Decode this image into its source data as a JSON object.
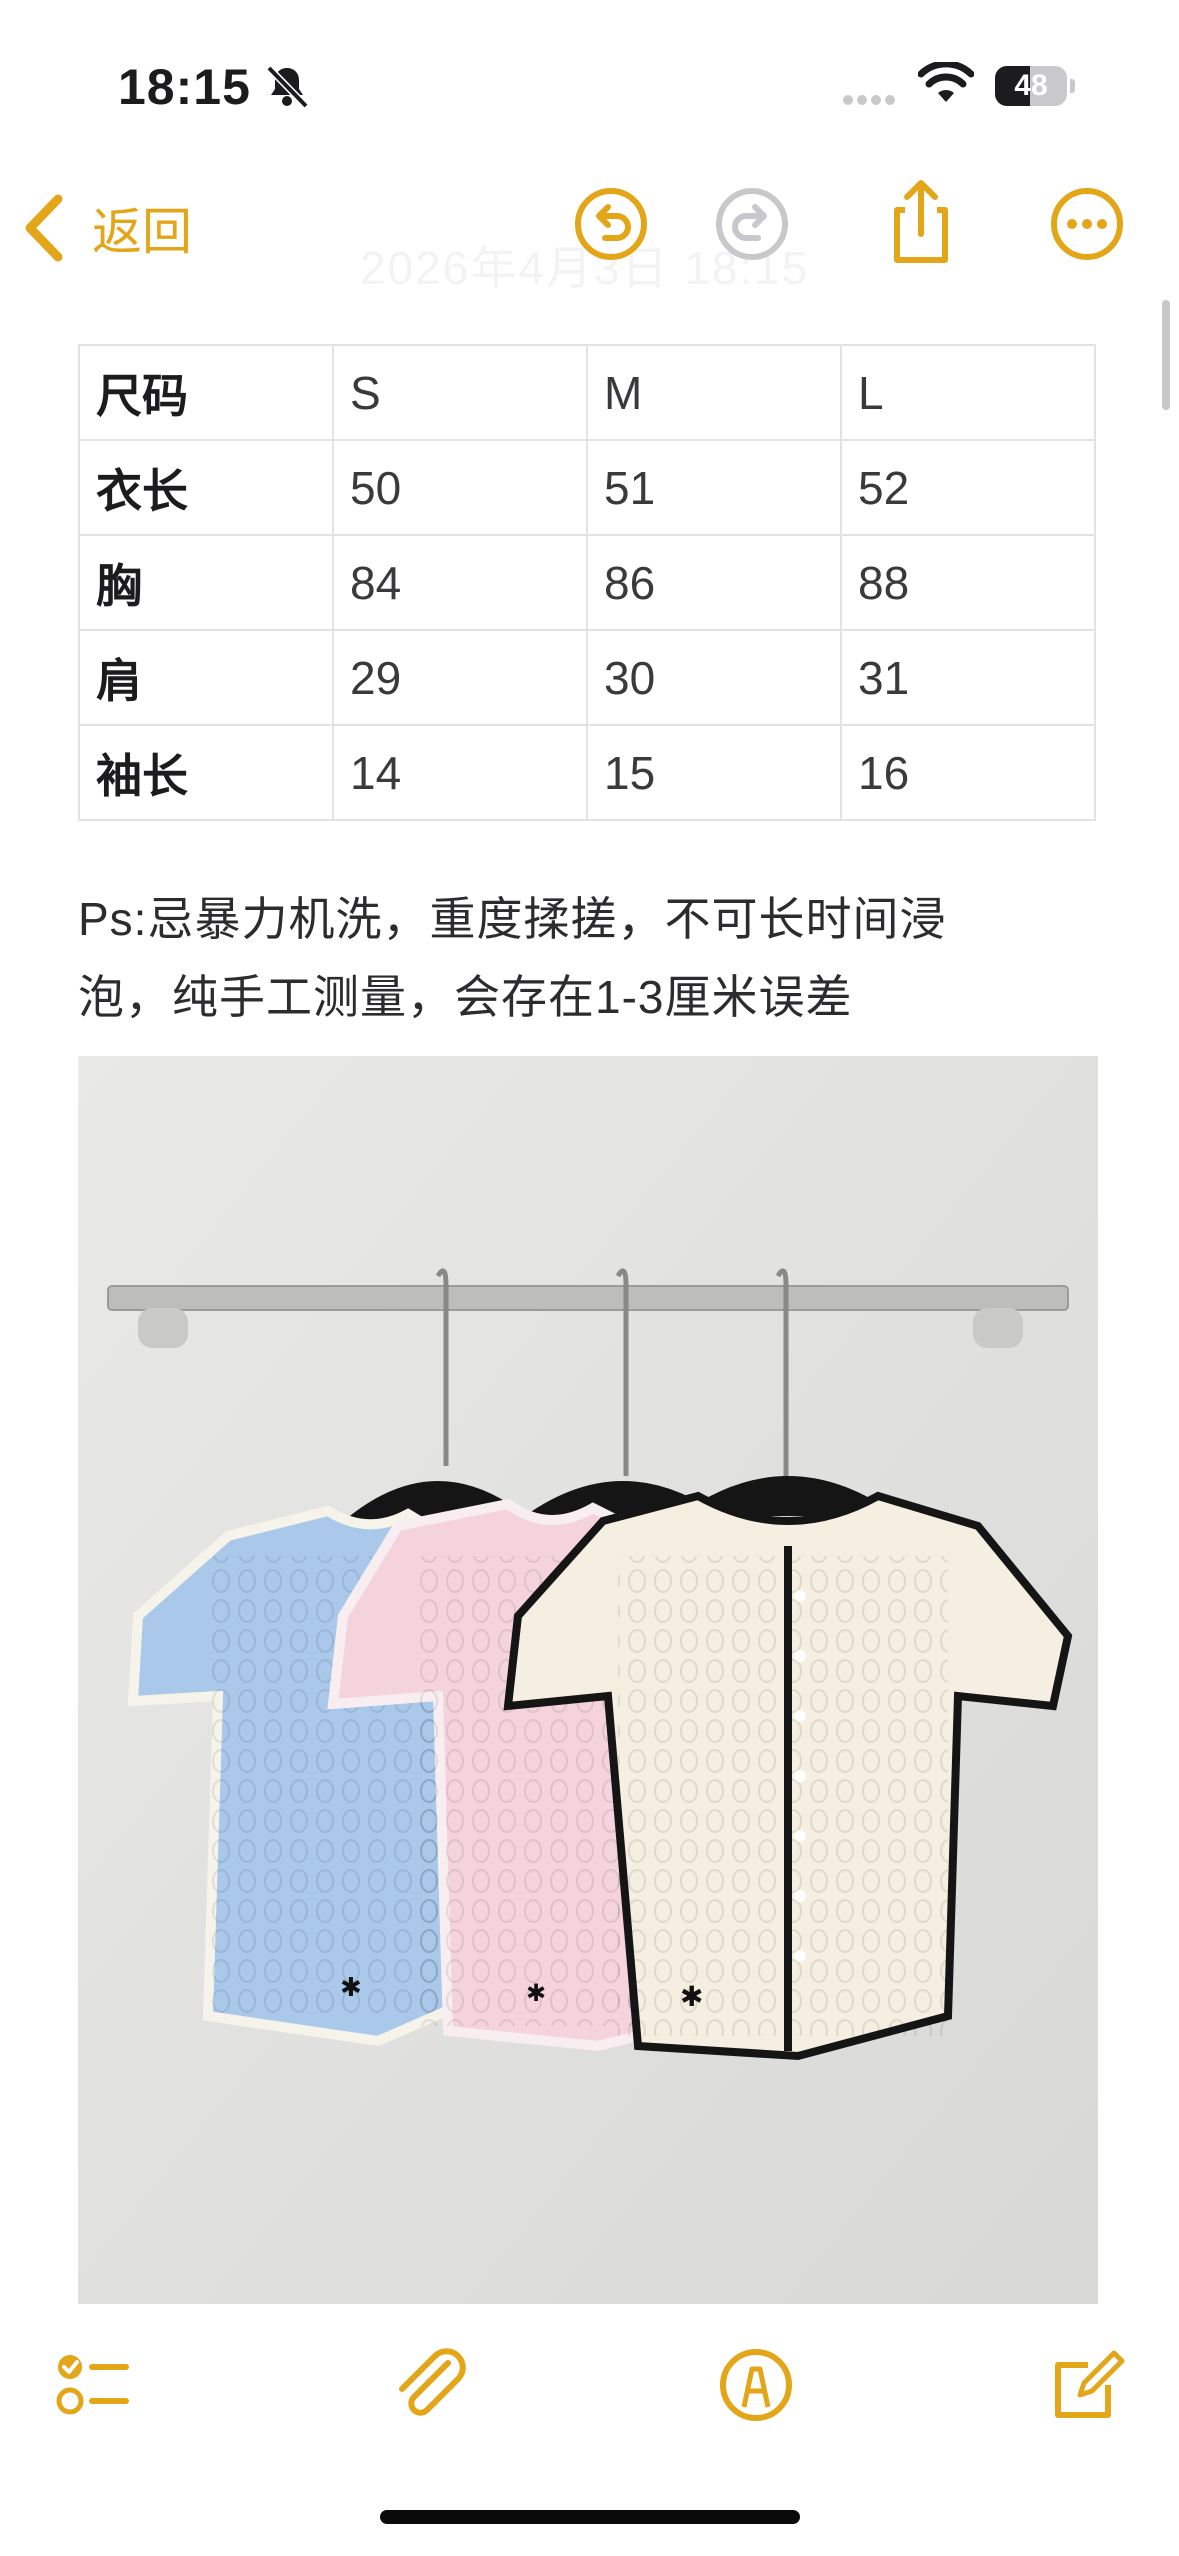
{
  "status_bar": {
    "time": "18:15",
    "battery_level": "48",
    "battery_fraction": 0.48
  },
  "nav": {
    "back_label": "返回",
    "faded_date": "2026年4月3日 18:15",
    "accent_color": "#e3a619",
    "icons": [
      "undo-icon",
      "redo-icon",
      "share-icon",
      "more-icon"
    ]
  },
  "table": {
    "rows": [
      [
        "尺码",
        "S",
        "M",
        "L"
      ],
      [
        "衣长",
        "50",
        "51",
        "52"
      ],
      [
        "胸",
        "84",
        "86",
        "88"
      ],
      [
        "肩",
        "29",
        "30",
        "31"
      ],
      [
        "袖长",
        "14",
        "15",
        "16"
      ]
    ]
  },
  "note": {
    "line1": "Ps:忌暴力机洗，重度揉搓，不可长时间浸",
    "line2": "泡，纯手工测量，会存在1-3厘米误差"
  },
  "photo": {
    "garment_colors": [
      "#a9c8ea",
      "#f5d3dd",
      "#f4efe0"
    ]
  },
  "toolbar": {
    "icons": [
      "checklist-icon",
      "attachment-icon",
      "markup-icon",
      "compose-icon"
    ]
  }
}
